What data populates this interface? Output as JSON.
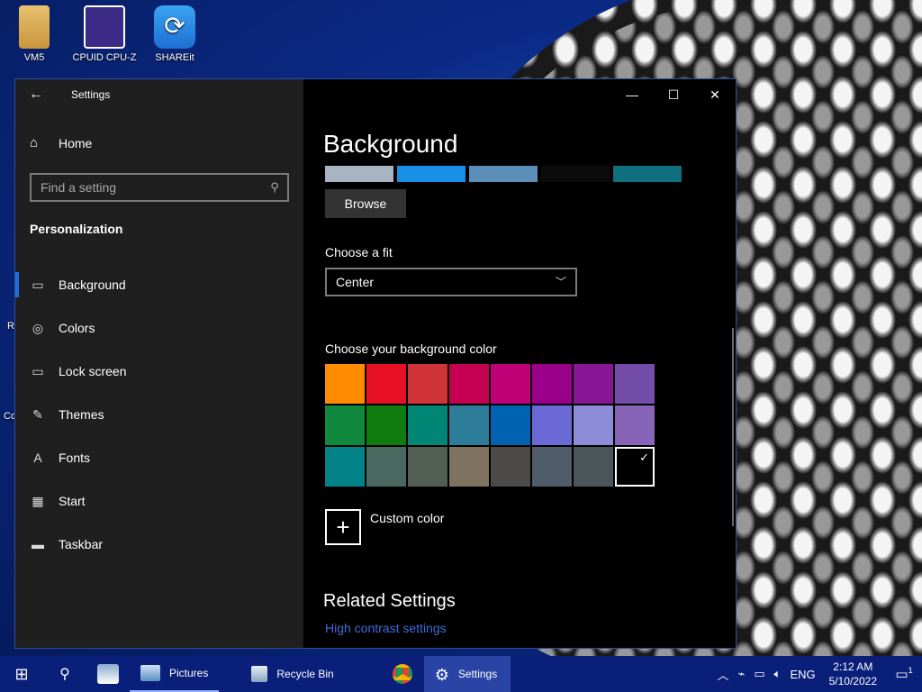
{
  "desktop": {
    "icons": [
      {
        "label": "VM5",
        "icon": "folder-user-icon"
      },
      {
        "label": "CPUID CPU-Z",
        "icon": "cpuz-icon"
      },
      {
        "label": "SHAREit",
        "icon": "shareit-icon"
      }
    ],
    "edge_labels": [
      "R",
      "Co"
    ]
  },
  "window": {
    "title": "Settings",
    "controls": {
      "minimize": "—",
      "maximize": "☐",
      "close": "✕"
    }
  },
  "sidebar": {
    "home": "Home",
    "search_placeholder": "Find a setting",
    "section": "Personalization",
    "items": [
      {
        "label": "Background",
        "icon": "background-icon",
        "glyph": "▭",
        "active": true
      },
      {
        "label": "Colors",
        "icon": "palette-icon",
        "glyph": "◎",
        "active": false
      },
      {
        "label": "Lock screen",
        "icon": "lock-screen-icon",
        "glyph": "▭",
        "active": false
      },
      {
        "label": "Themes",
        "icon": "themes-icon",
        "glyph": "✎",
        "active": false
      },
      {
        "label": "Fonts",
        "icon": "fonts-icon",
        "glyph": "A",
        "active": false
      },
      {
        "label": "Start",
        "icon": "start-icon",
        "glyph": "▦",
        "active": false
      },
      {
        "label": "Taskbar",
        "icon": "taskbar-icon",
        "glyph": "▬",
        "active": false
      }
    ]
  },
  "content": {
    "title": "Background",
    "browse_label": "Browse",
    "fit_label": "Choose a fit",
    "fit_value": "Center",
    "color_label": "Choose your background color",
    "colors": [
      "#FF8C00",
      "#E81123",
      "#D13438",
      "#C30052",
      "#BF0077",
      "#9A0089",
      "#881798",
      "#744DA9",
      "#10893E",
      "#107C10",
      "#018574",
      "#2D7D9A",
      "#0063B1",
      "#6B69D6",
      "#8E8CD8",
      "#8764B8",
      "#038387",
      "#486860",
      "#525E54",
      "#7E735F",
      "#4C4A48",
      "#515C6B",
      "#4A5459",
      "#000000"
    ],
    "selected_color_index": 23,
    "custom_color": "Custom color",
    "related_title": "Related Settings",
    "high_contrast_link": "High contrast settings",
    "thumbnails": [
      "#a9b4c2",
      "#1a8fe8",
      "#5b8fb8",
      "#0b0b0b",
      "#0f6f7f"
    ]
  },
  "taskbar": {
    "apps": [
      {
        "label": "Pictures",
        "icon": "pictures-icon",
        "active": false
      },
      {
        "label": "Recycle Bin",
        "icon": "recycle-bin-icon",
        "active": false
      },
      {
        "label": "Settings",
        "icon": "gear-icon",
        "active": true
      }
    ],
    "language": "ENG",
    "time": "2:12 AM",
    "date": "5/10/2022",
    "notifications": "1"
  }
}
